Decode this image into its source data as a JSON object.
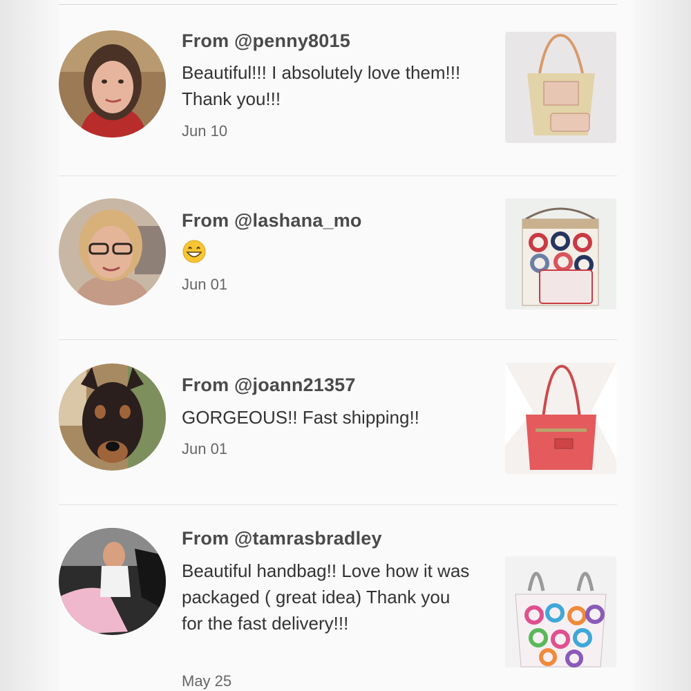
{
  "reviews": [
    {
      "from": "From @penny8015",
      "message": "Beautiful!!! I absolutely love them!!! Thank you!!!",
      "date": "Jun 10"
    },
    {
      "from": "From @lashana_mo",
      "message": "😁",
      "date": "Jun 01"
    },
    {
      "from": "From @joann21357",
      "message": "GORGEOUS!! Fast shipping!!",
      "date": "Jun 01"
    },
    {
      "from": "From @tamrasbradley",
      "message": "Beautiful handbag!!  Love how it was packaged ( great idea) Thank you for the fast delivery!!!",
      "date": "May 25"
    }
  ],
  "icons": {
    "avatar": "user-photo",
    "thumb": "product-photo",
    "emoji": "grinning-face-emoji"
  }
}
